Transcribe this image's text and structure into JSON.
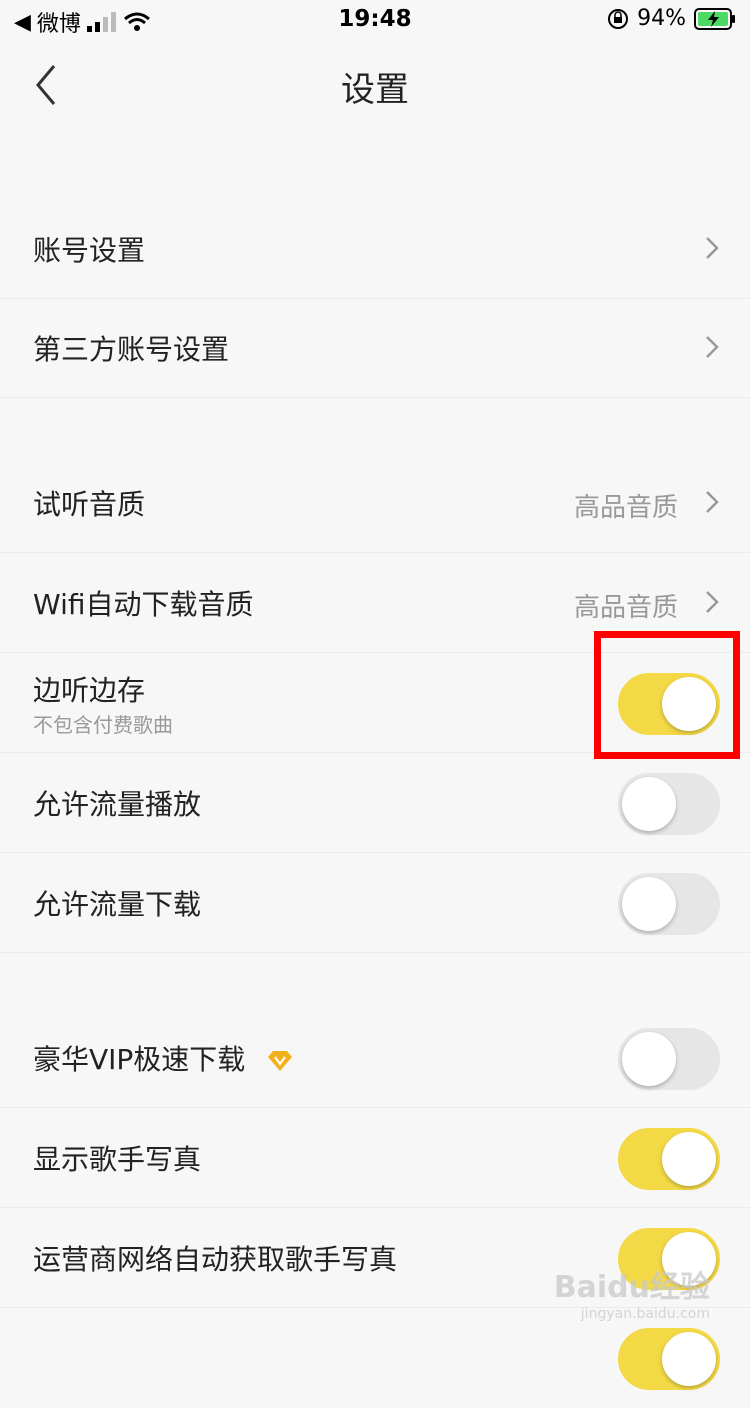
{
  "status_bar": {
    "back_app": "微博",
    "time": "19:48",
    "battery": "94%"
  },
  "nav": {
    "title": "设置"
  },
  "rows": {
    "account": {
      "label": "账号设置"
    },
    "third_party": {
      "label": "第三方账号设置"
    },
    "listen_quality": {
      "label": "试听音质",
      "value": "高品音质"
    },
    "wifi_download_quality": {
      "label": "Wifi自动下载音质",
      "value": "高品音质"
    },
    "listen_and_save": {
      "label": "边听边存",
      "sublabel": "不包含付费歌曲",
      "on": true
    },
    "allow_data_play": {
      "label": "允许流量播放",
      "on": false
    },
    "allow_data_download": {
      "label": "允许流量下载",
      "on": false
    },
    "vip_fast_download": {
      "label": "豪华VIP极速下载",
      "icon": "vip-diamond-icon",
      "on": false
    },
    "show_singer_photo": {
      "label": "显示歌手写真",
      "on": true
    },
    "carrier_fetch_photo": {
      "label": "运营商网络自动获取歌手写真",
      "on": true
    }
  },
  "watermark": {
    "text": "Baidu经验",
    "sub": "jingyan.baidu.com"
  },
  "colors": {
    "toggle_on": "#f4d946",
    "toggle_off": "#e6e6e6",
    "highlight": "#ff0000"
  }
}
